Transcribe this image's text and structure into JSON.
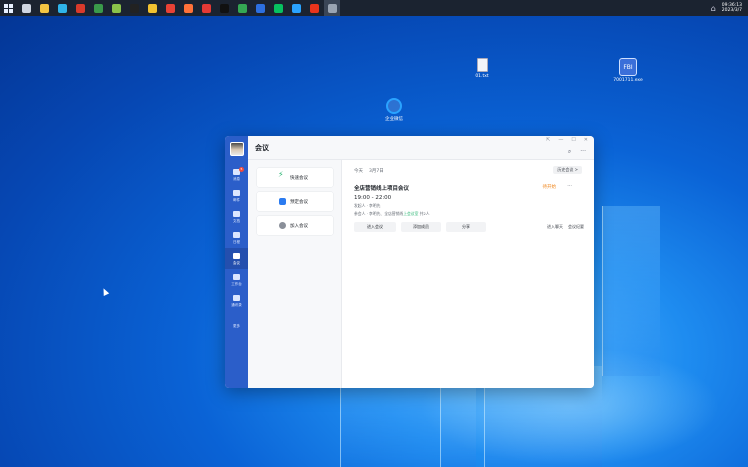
{
  "taskbar": {
    "apps": [
      {
        "name": "search-icon",
        "color": "#cfd6e2"
      },
      {
        "name": "file-explorer-icon",
        "color": "#f4c542"
      },
      {
        "name": "edge-icon",
        "color": "#2fb4e9"
      },
      {
        "name": "filezilla-icon",
        "color": "#d93a2b"
      },
      {
        "name": "tool-icon",
        "color": "#3a9a4a"
      },
      {
        "name": "green-app-icon",
        "color": "#8bc34a"
      },
      {
        "name": "qq-icon",
        "color": "#222222"
      },
      {
        "name": "note-icon",
        "color": "#f2c230"
      },
      {
        "name": "chrome-icon",
        "color": "#e94235"
      },
      {
        "name": "firefox-icon",
        "color": "#ff7139"
      },
      {
        "name": "red-app-icon",
        "color": "#e53935"
      },
      {
        "name": "tiktok-icon",
        "color": "#111111"
      },
      {
        "name": "browser-icon",
        "color": "#34a853"
      },
      {
        "name": "mail-icon",
        "color": "#2d6fe0"
      },
      {
        "name": "wechat-icon",
        "color": "#07c160"
      },
      {
        "name": "wecom-taskbar-icon",
        "color": "#2aa3ff"
      },
      {
        "name": "wps-icon",
        "color": "#e8341c"
      },
      {
        "name": "camera-icon",
        "color": "#9aa4b2"
      }
    ],
    "clock_time": "09:36:13",
    "clock_date": "2023/3/7"
  },
  "desktop_icons": [
    {
      "label": "01.txt"
    },
    {
      "label": "7001711.exe",
      "glyph": "FBI"
    },
    {
      "label": "企业微信"
    }
  ],
  "window": {
    "title": "会议",
    "controls": {
      "pin": "⇱",
      "minimize": "—",
      "maximize": "☐",
      "close": "✕"
    },
    "search_icon": "⌕",
    "more_icon": "···",
    "sidebar": {
      "badge": "5",
      "items": [
        {
          "label": "消息",
          "icon": "message-icon"
        },
        {
          "label": "邮件",
          "icon": "mail-icon"
        },
        {
          "label": "文档",
          "icon": "doc-icon"
        },
        {
          "label": "日程",
          "icon": "calendar-icon"
        },
        {
          "label": "会议",
          "icon": "meeting-icon",
          "active": true
        },
        {
          "label": "工作台",
          "icon": "workbench-icon"
        },
        {
          "label": "通讯录",
          "icon": "contacts-icon"
        }
      ],
      "more_label": "更多"
    },
    "actions": [
      {
        "label": "快速会议",
        "color": "#2bb673"
      },
      {
        "label": "预定会议",
        "color": "#2b7bf0"
      },
      {
        "label": "加入会议",
        "color": "#8a8f99"
      }
    ],
    "schedule": {
      "today": "今天",
      "date": "3月7日",
      "history_button": "历史会议 >",
      "meeting": {
        "title": "全店营销线上项目会议",
        "status": "待开始",
        "more": "···",
        "time": "19:00 - 22:00",
        "organizer": "发起人 · 李明先",
        "participants_prefix": "参会人 · 李明先、全店营销线",
        "participants_highlight": "上会议室",
        "participants_suffix": "共2人",
        "buttons": {
          "enter": "进入会议",
          "add_participants": "添加成员",
          "share": "分享"
        },
        "link_chat": "进入聊天",
        "link_detail": "会议纪要"
      }
    }
  }
}
